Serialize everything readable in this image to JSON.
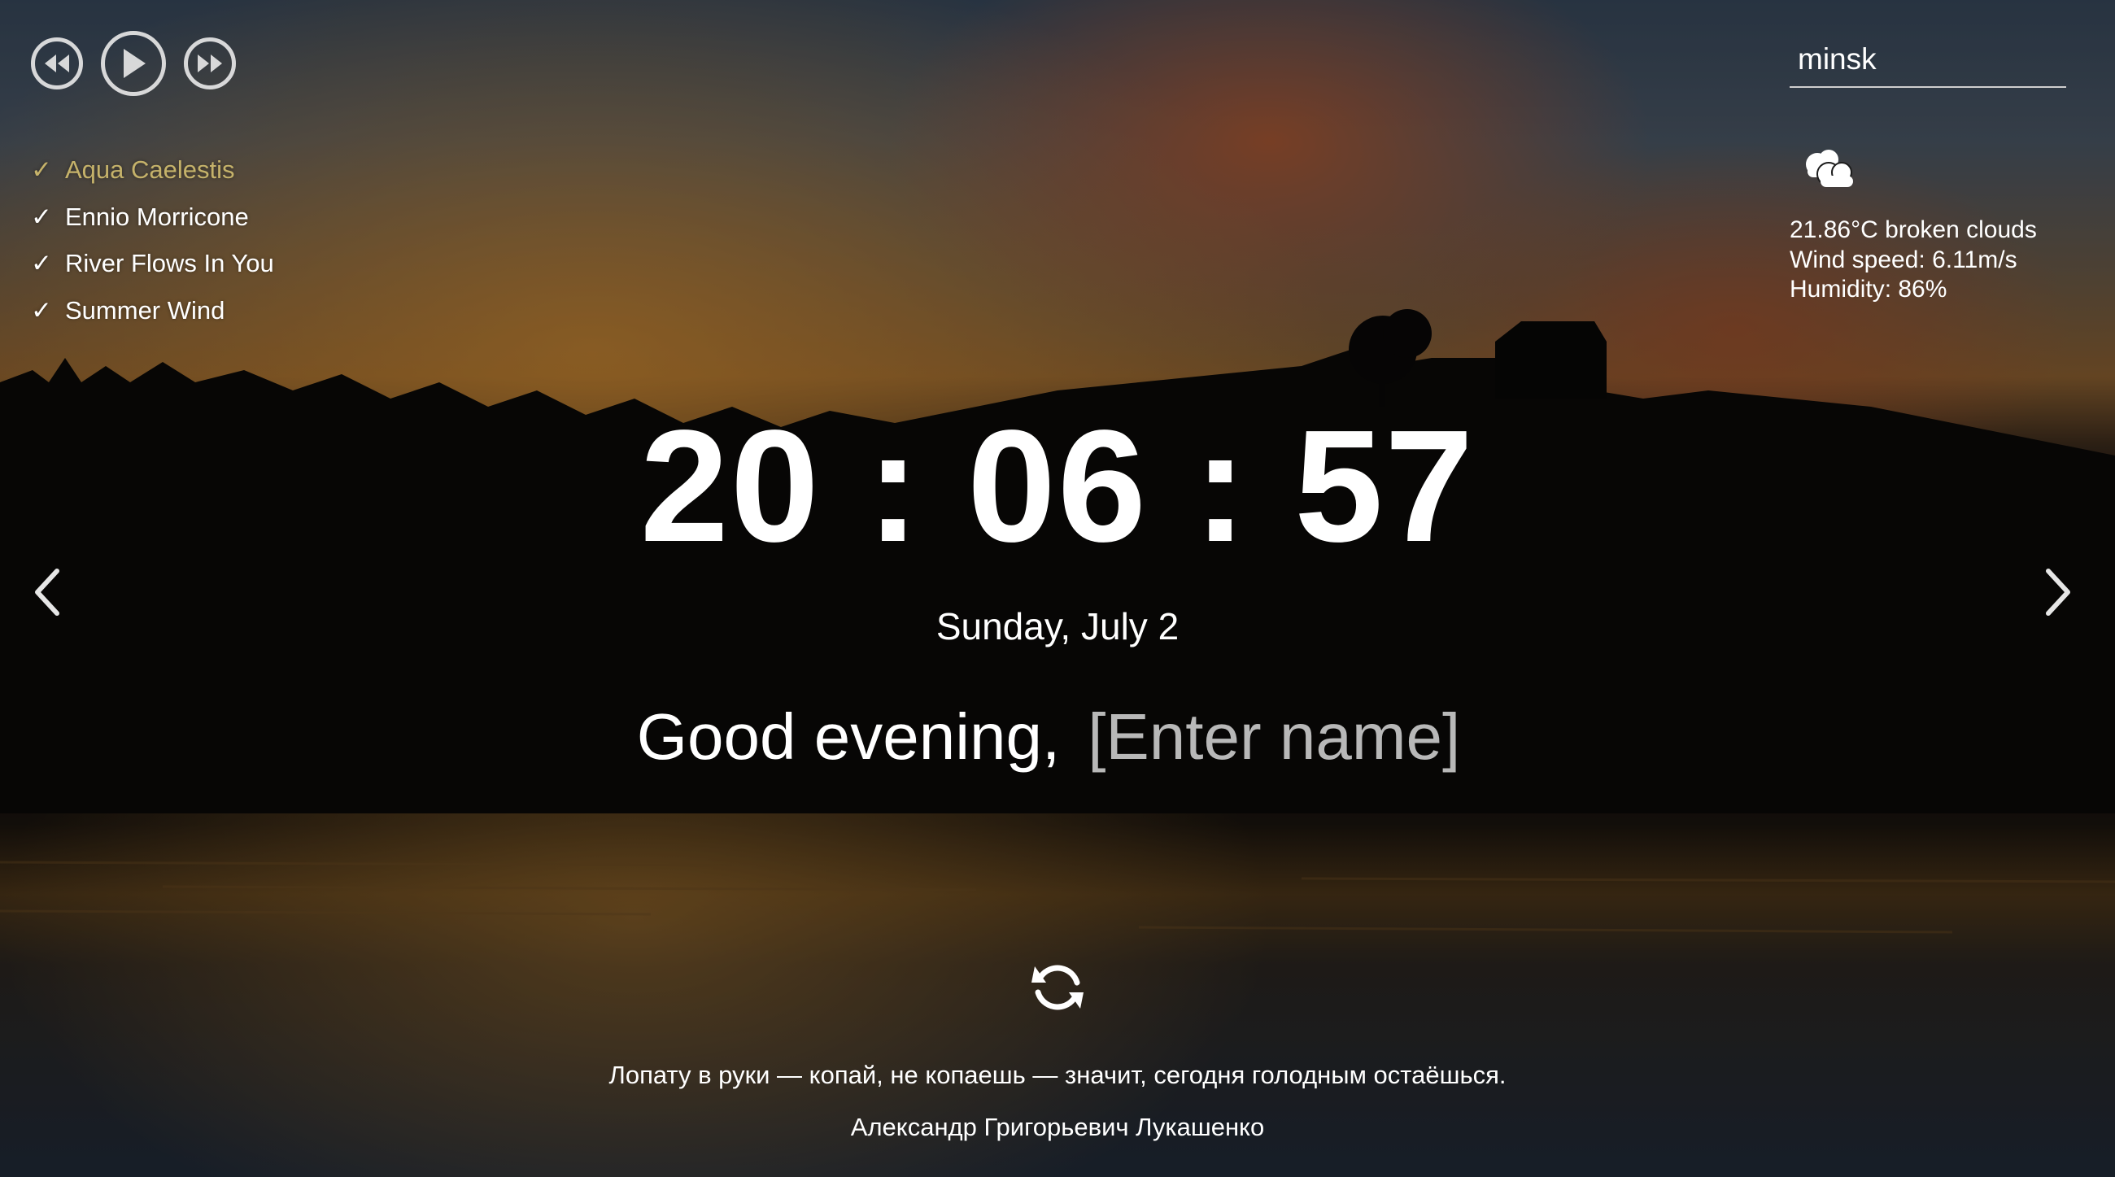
{
  "player": {
    "prev_icon": "rewind-icon",
    "play_icon": "play-icon",
    "next_icon": "fast-forward-icon",
    "playlist": [
      {
        "check": "✓",
        "title": "Aqua Caelestis",
        "active": true
      },
      {
        "check": "✓",
        "title": "Ennio Morricone",
        "active": false
      },
      {
        "check": "✓",
        "title": "River Flows In You",
        "active": false
      },
      {
        "check": "✓",
        "title": "Summer Wind",
        "active": false
      }
    ],
    "active_color": "#c5b26a"
  },
  "weather": {
    "city": "minsk",
    "icon": "broken-clouds-icon",
    "description": "21.86°C broken clouds",
    "wind": "Wind speed: 6.11m/s",
    "humidity": "Humidity: 86%"
  },
  "slider": {
    "prev_icon": "chevron-left-icon",
    "next_icon": "chevron-right-icon"
  },
  "clock": {
    "time": "20 : 06 : 57",
    "date": "Sunday, July 2"
  },
  "greeting": {
    "text": "Good evening,",
    "name_placeholder": "[Enter name]",
    "name_value": ""
  },
  "quote": {
    "refresh_icon": "refresh-icon",
    "text": "Лопату в руки — копай, не копаешь — значит, сегодня голодным остаёшься.",
    "author": "Александр Григорьевич Лукашенко"
  }
}
